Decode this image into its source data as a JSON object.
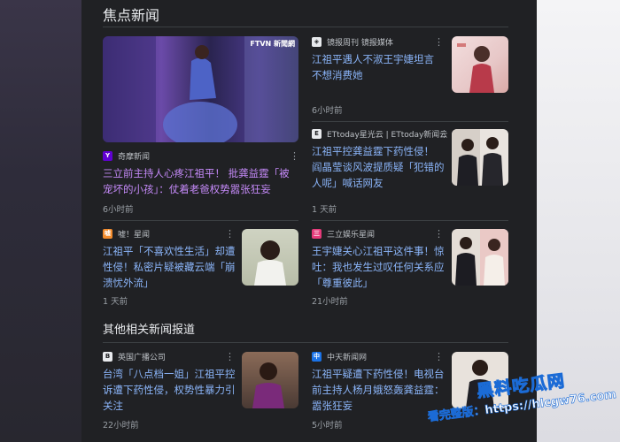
{
  "section_title": "焦点新闻",
  "section2_title": "其他相关新闻报道",
  "featured": {
    "overlay_logo": "FTVN 新聞網",
    "source": "奇摩新闻",
    "headline": "三立前主持人心疼江祖平！ 批龚益霆「被宠坏的小孩」：仗着老爸权势嚣张狂妄",
    "time": "6小时前"
  },
  "news": [
    {
      "source": "镜报周刊 镜报媒体",
      "headline": "江祖平遇人不淑王宇婕坦言不想消费她",
      "time": "6小时前"
    },
    {
      "source": "ETtoday星光云 | ETtoday新闻云",
      "headline": "江祖平控龚益霆下药性侵！ 阎晶莹谈风波提质疑「犯错的人呢」喊话网友",
      "time": "1 天前"
    },
    {
      "source": "嘘！星闻",
      "headline": "江祖平「不喜欢性生活」却遭性侵！私密片疑被藏云端「崩溃忧外流」",
      "time": "1 天前"
    },
    {
      "source": "三立娱乐星闻",
      "headline": "王宇婕关心江祖平这件事！惊吐：我也发生过叹任何关系应「尊重彼此」",
      "time": "21小时前"
    }
  ],
  "other_news": [
    {
      "source": "英国广播公司",
      "headline": "台湾「八点档一姐」江祖平控诉遭下药性侵，权势性暴力引关注",
      "time": "22小时前"
    },
    {
      "source": "中天新闻网",
      "headline": "江祖平疑遭下药性侵！电视台前主持人杨月娥怒轰龚益霆：嚣张狂妄",
      "time": "5小时前"
    }
  ],
  "watermark": {
    "line1": "黑料吃瓜网",
    "line2": "看完整版：https://hlcgw76.com"
  },
  "colors": {
    "link": "#8ab4f8",
    "visited": "#c58af9",
    "panel": "#202124"
  }
}
